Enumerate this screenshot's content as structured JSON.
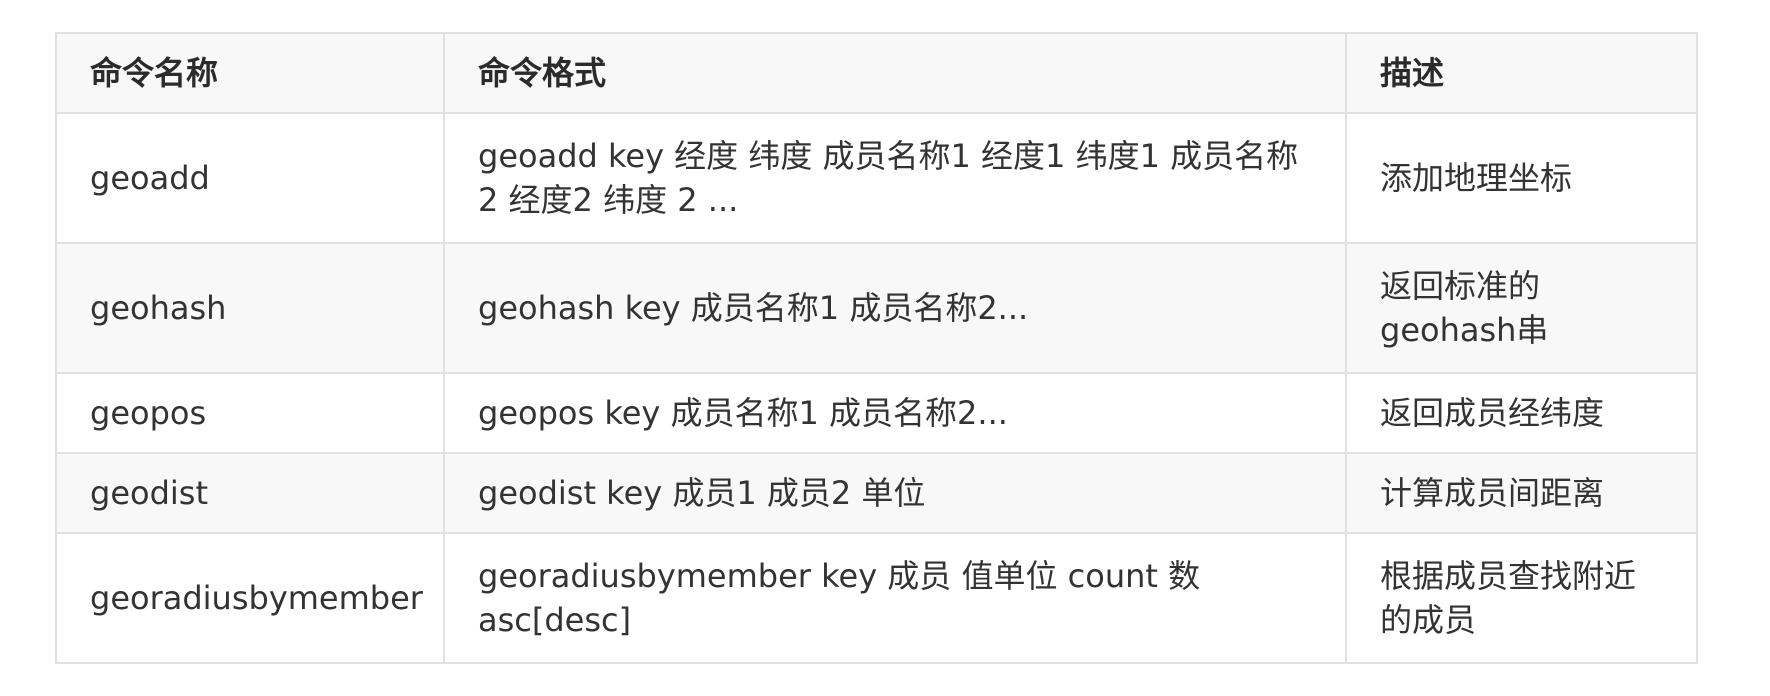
{
  "table": {
    "headers": [
      "命令名称",
      "命令格式",
      "描述"
    ],
    "rows": [
      [
        "geoadd",
        "geoadd key 经度 纬度 成员名称1 经度1 纬度1 成员名称2 经度2 纬度 2 ...",
        "添加地理坐标"
      ],
      [
        "geohash",
        "geohash key 成员名称1 成员名称2...",
        "返回标准的geohash串"
      ],
      [
        "geopos",
        "geopos key 成员名称1 成员名称2...",
        "返回成员经纬度"
      ],
      [
        "geodist",
        "geodist key 成员1 成员2 单位",
        "计算成员间距离"
      ],
      [
        "georadiusbymember",
        "georadiusbymember key 成员 值单位 count 数 asc[desc]",
        "根据成员查找附近的成员"
      ]
    ]
  }
}
